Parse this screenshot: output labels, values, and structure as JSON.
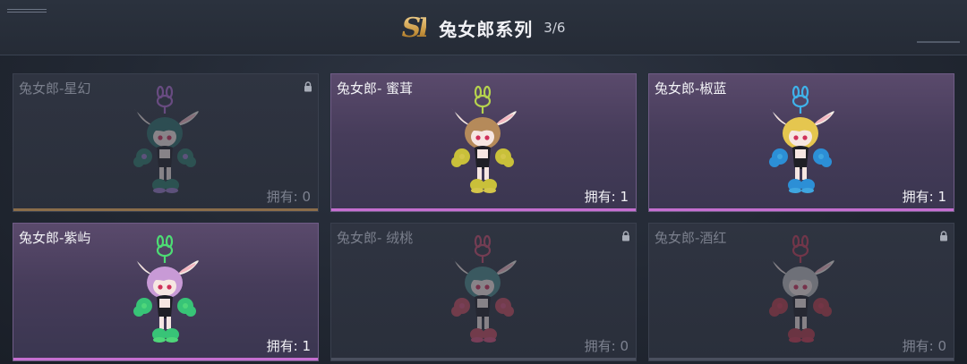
{
  "header": {
    "logo": "SI",
    "title": "兔女郎系列",
    "count": "3/6"
  },
  "cards": [
    {
      "name": "兔女郎-星幻",
      "own": "拥有: 0",
      "state": "locked",
      "accent": "#9a7bc8",
      "hair": "#2f6e6a",
      "limbs": "#2f7c6c",
      "keychain": "#b06ad0"
    },
    {
      "name": "兔女郎- 蜜茸",
      "own": "拥有: 1",
      "state": "owned",
      "accent": "#d4c64a",
      "hair": "#b58a5a",
      "limbs": "#c9c03a",
      "keychain": "#b6d24e"
    },
    {
      "name": "兔女郎-椒蓝",
      "own": "拥有: 1",
      "state": "owned",
      "accent": "#3fa6e0",
      "hair": "#e5c64f",
      "limbs": "#2c8fd6",
      "keychain": "#3fb2ea"
    },
    {
      "name": "兔女郎-紫屿",
      "own": "拥有: 1",
      "state": "owned",
      "accent": "#4fd67a",
      "hair": "#c89ad6",
      "limbs": "#38c477",
      "keychain": "#4ddc74"
    },
    {
      "name": "兔女郎- 绒桃",
      "own": "拥有: 0",
      "state": "locked",
      "accent": "#d6507a",
      "hair": "#4a8a8a",
      "limbs": "#c84a5e",
      "keychain": "#c84a6a"
    },
    {
      "name": "兔女郎-酒红",
      "own": "拥有: 0",
      "state": "locked",
      "accent": "#cc3b52",
      "hair": "#bdbdbd",
      "limbs": "#b83a4a",
      "keychain": "#c23a56"
    }
  ]
}
